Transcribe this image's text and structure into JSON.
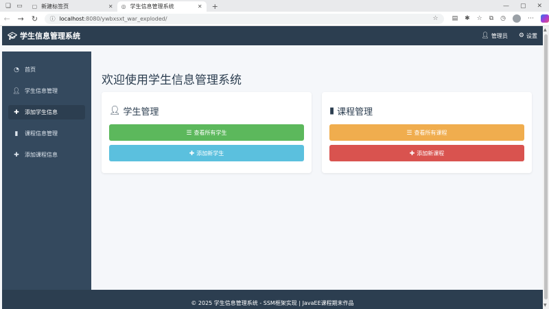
{
  "browser": {
    "tabs": [
      {
        "label": "新建标签页",
        "active": false
      },
      {
        "label": "学生信息管理系统",
        "active": true
      }
    ],
    "new_tab_glyph": "+",
    "url_host": "localhost",
    "url_path": ":8080/ywbxsxt_war_exploded/"
  },
  "app": {
    "brand": "学生信息管理系统",
    "topbar": {
      "admin_label": "管理员",
      "settings_label": "设置"
    },
    "sidebar": {
      "items": [
        {
          "label": "首页",
          "icon": "dashboard-icon",
          "active": false
        },
        {
          "label": "学生信息管理",
          "icon": "user-icon",
          "active": false
        },
        {
          "label": "添加学生信息",
          "icon": "plus-icon",
          "active": true
        },
        {
          "label": "课程信息管理",
          "icon": "book-icon",
          "active": false
        },
        {
          "label": "添加课程信息",
          "icon": "plus-icon",
          "active": false
        }
      ]
    },
    "main": {
      "title": "欢迎使用学生信息管理系统",
      "cards": [
        {
          "title": "学生管理",
          "icon": "user-icon",
          "buttons": [
            {
              "label": "查看所有学生",
              "icon": "list-icon",
              "color": "#5cb85c"
            },
            {
              "label": "添加新学生",
              "icon": "plus-icon",
              "color": "#5bc0de"
            }
          ]
        },
        {
          "title": "课程管理",
          "icon": "book-icon",
          "buttons": [
            {
              "label": "查看所有课程",
              "icon": "list-icon",
              "color": "#f0ad4e"
            },
            {
              "label": "添加新课程",
              "icon": "plus-icon",
              "color": "#d9534f"
            }
          ]
        }
      ]
    },
    "footer": "© 2025 学生信息管理系统 - SSM框架实现 | JavaEE课程期末作品"
  },
  "colors": {
    "navbar": "#2c3e50",
    "sidebar": "#34495e",
    "content_bg": "#f5f7fa"
  }
}
